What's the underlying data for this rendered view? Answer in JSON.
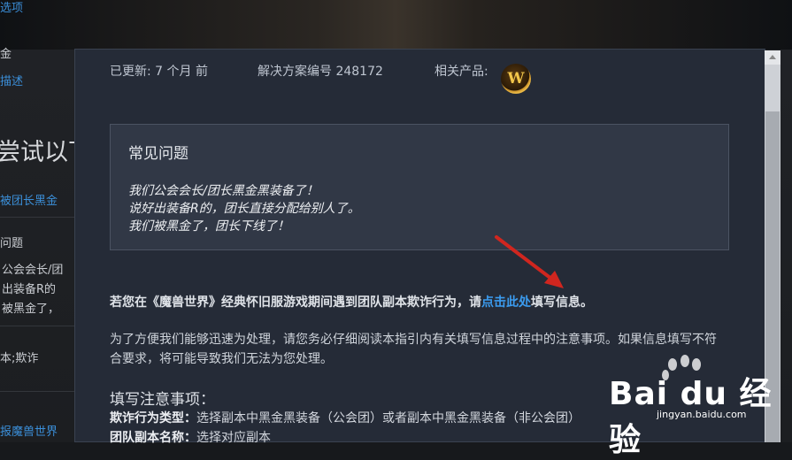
{
  "background": {
    "options_link": "选项",
    "gold_text": "金",
    "describe_link": "描述",
    "try_heading": "尝试以下",
    "leader_link": "被团长黑金",
    "faq_text": "问题",
    "line1": "公会会长/团",
    "line2": "出装备R的",
    "line3": "被黑金了，",
    "tags_text": "本;欺诈",
    "report_link": "报魔兽世界"
  },
  "meta": {
    "updated_label": "已更新: 7 个月 前",
    "solution_label": "解决方案编号 248172",
    "product_label": "相关产品:",
    "product_icon": "W"
  },
  "faq": {
    "title": "常见问题",
    "questions": [
      "我们公会会长/团长黑金黑装备了！",
      "说好出装备R的，团长直接分配给别人了。",
      "我们被黑金了，团长下线了！"
    ]
  },
  "body": {
    "para1_before": "若您在《魔兽世界》经典怀旧服游戏期间遇到团队副本欺诈行为，请",
    "para1_link": "点击此处",
    "para1_after": "填写信息。",
    "para2": "为了方便我们能够迅速为处理，请您务必仔细阅读本指引内有关填写信息过程中的注意事项。如果信息填写不符合要求，将可能导致我们无法为您处理。",
    "notes_title": "填写注意事项：",
    "note1_label": "欺诈行为类型：",
    "note1_text": "选择副本中黑金黑装备（公会团）或者副本中黑金黑装备（非公会团）",
    "note2_label": "团队副本名称：",
    "note2_text": "选择对应副本"
  },
  "watermark": {
    "text": "Bai du 经验",
    "url": "jingyan.baidu.com"
  },
  "colors": {
    "link": "#3b9cf0",
    "modal_bg": "#252b37",
    "arrow": "#d0261f"
  }
}
